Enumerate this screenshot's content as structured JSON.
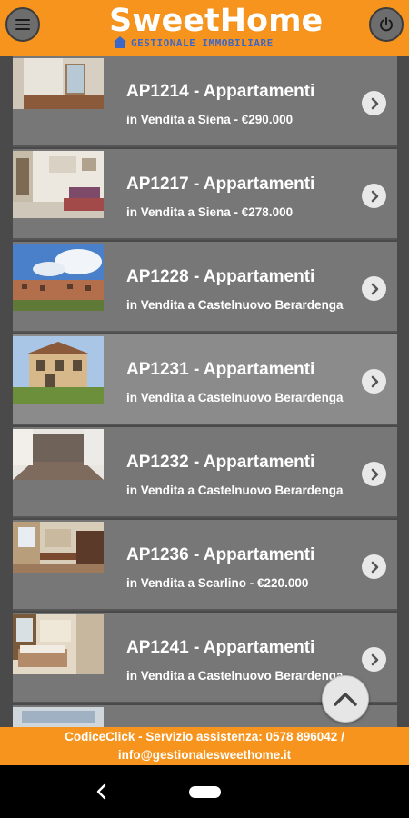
{
  "header": {
    "logo_title": "SweetHome",
    "logo_subtitle": "GESTIONALE IMMOBILIARE",
    "menu_icon": "hamburger-menu-icon",
    "power_icon": "power-icon"
  },
  "listings": [
    {
      "title": "AP1214 - Appartamenti",
      "subtitle": "in Vendita a Siena - €290.000"
    },
    {
      "title": "AP1217 - Appartamenti",
      "subtitle": "in Vendita a Siena - €278.000"
    },
    {
      "title": "AP1228 - Appartamenti",
      "subtitle": "in Vendita a Castelnuovo Berardenga"
    },
    {
      "title": "AP1231 - Appartamenti",
      "subtitle": "in Vendita a Castelnuovo Berardenga"
    },
    {
      "title": "AP1232 - Appartamenti",
      "subtitle": "in Vendita a Castelnuovo Berardenga"
    },
    {
      "title": "AP1236 - Appartamenti",
      "subtitle": "in Vendita a Scarlino - €220.000"
    },
    {
      "title": "AP1241 - Appartamenti",
      "subtitle": "in Vendita a Castelnuovo Berardenga"
    }
  ],
  "footer": {
    "line1": "CodiceClick - Servizio assistenza: 0578 896042 /",
    "line2": "info@gestionalesweethome.it"
  },
  "colors": {
    "brand_orange": "#f7941d",
    "list_background": "#777777",
    "logo_blue": "#3b67c9"
  }
}
